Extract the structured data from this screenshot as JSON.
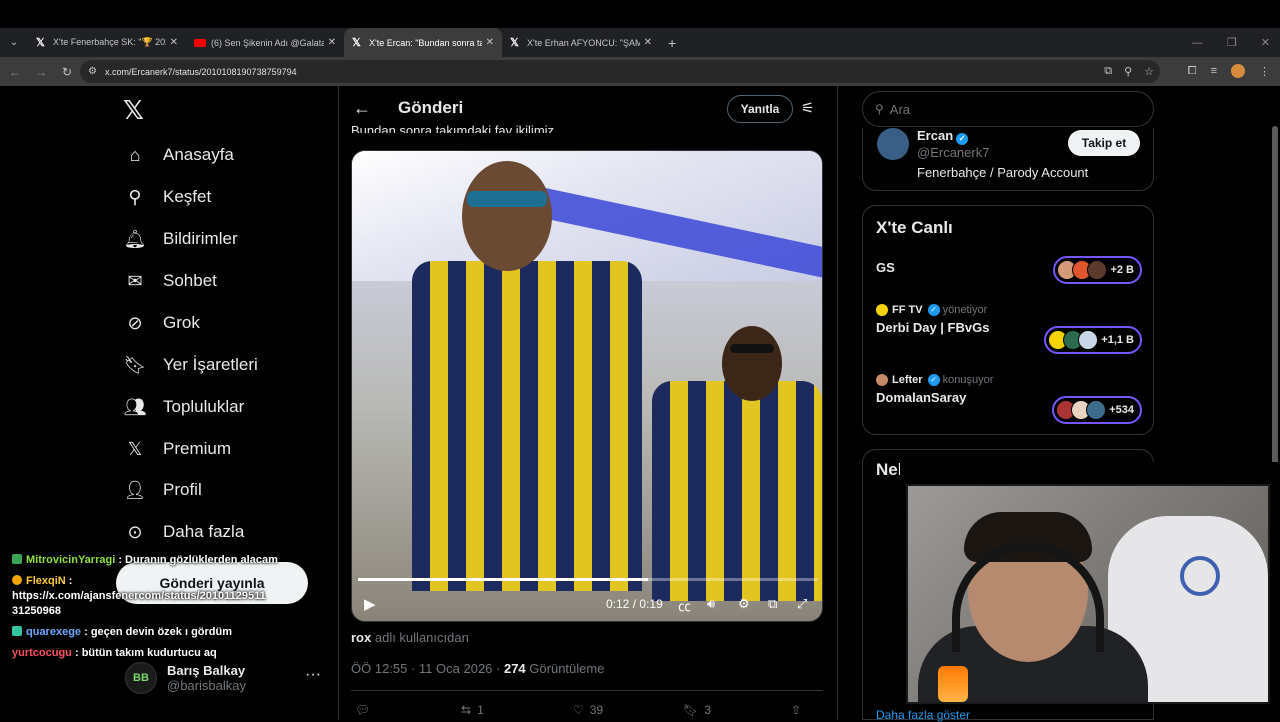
{
  "browser": {
    "tabs": [
      {
        "title": "X'te Fenerbahçe SK: \"🏆 2025 'i",
        "favicon": "x-icon",
        "active": false
      },
      {
        "title": "(6) Sen Şikenin Adı @Galatasar",
        "favicon": "youtube-icon",
        "active": false
      },
      {
        "title": "X'te Ercan: \"Bundan sonra takım",
        "favicon": "x-icon",
        "active": true
      },
      {
        "title": "X'te Erhan AFYONCU: \"ŞAMPİYO",
        "favicon": "x-icon",
        "active": false
      }
    ],
    "url": "x.com/Ercanerk7/status/2010108190738759794"
  },
  "sidebar": {
    "items": [
      {
        "label": "Anasayfa",
        "icon": "home-icon"
      },
      {
        "label": "Keşfet",
        "icon": "search-icon"
      },
      {
        "label": "Bildirimler",
        "icon": "bell-icon"
      },
      {
        "label": "Sohbet",
        "icon": "mail-icon"
      },
      {
        "label": "Grok",
        "icon": "grok-icon"
      },
      {
        "label": "Yer İşaretleri",
        "icon": "bookmark-icon"
      },
      {
        "label": "Topluluklar",
        "icon": "people-icon"
      },
      {
        "label": "Premium",
        "icon": "x-icon"
      },
      {
        "label": "Profil",
        "icon": "person-icon"
      },
      {
        "label": "Daha fazla",
        "icon": "more-circle-icon"
      }
    ],
    "post_button": "Gönderi yayınla",
    "user": {
      "name": "Barış Balkay",
      "handle": "@barisbalkay",
      "avatar_text": "BB"
    }
  },
  "chat": [
    {
      "user": "MitrovicinYarragi",
      "text": ": Duranın gözlüklerden alacam"
    },
    {
      "user": "FlexqiN",
      "text": ":"
    },
    {
      "user": "",
      "text": "https://x.com/ajansfenercom/status/20101129511"
    },
    {
      "user": "",
      "text": "31250968"
    },
    {
      "user": "quarexege",
      "text": ": geçen devin özek ı gördüm"
    },
    {
      "user": "yurtcocugu",
      "text": ": bütün takım kudurtucu aq"
    }
  ],
  "main": {
    "title": "Gönderi",
    "reply_button": "Yanıtla",
    "tweet_text": "Bundan sonra takımdaki fav ikilimiz",
    "video": {
      "current": "0:12",
      "separator": "/",
      "duration": "0:19",
      "progress": 0.63
    },
    "credit_user": "rox",
    "credit_suffix": "adlı kullanıcıdan",
    "time": "ÖÖ 12:55 · 11 Oca 2026 ·",
    "views": "274",
    "views_label": "Görüntüleme",
    "actions": {
      "retweets": "1",
      "likes": "39",
      "bookmarks": "3"
    }
  },
  "right": {
    "search_placeholder": "Ara",
    "who": {
      "name": "Ercan",
      "handle": "@Ercanerk7",
      "bio": "Fenerbahçe / Parody Account",
      "follow": "Takip et"
    },
    "live_title": "X'te Canlı",
    "spaces": [
      {
        "host": "",
        "role": "",
        "title": "GS",
        "count": "+2 B"
      },
      {
        "host": "FF TV",
        "role": "yönetiyor",
        "title": "Derbi Day | FBvGs",
        "count": "+1,1 B"
      },
      {
        "host": "Lefter",
        "role": "konuşuyor",
        "title": "DomalanSaray",
        "count": "+534"
      }
    ],
    "trend_title": "Neler oluyor?",
    "show_more": "Daha fazla göster"
  },
  "colors": {
    "accent": "#1d9bf0",
    "space_border": "#7856ff",
    "background": "#000000"
  }
}
